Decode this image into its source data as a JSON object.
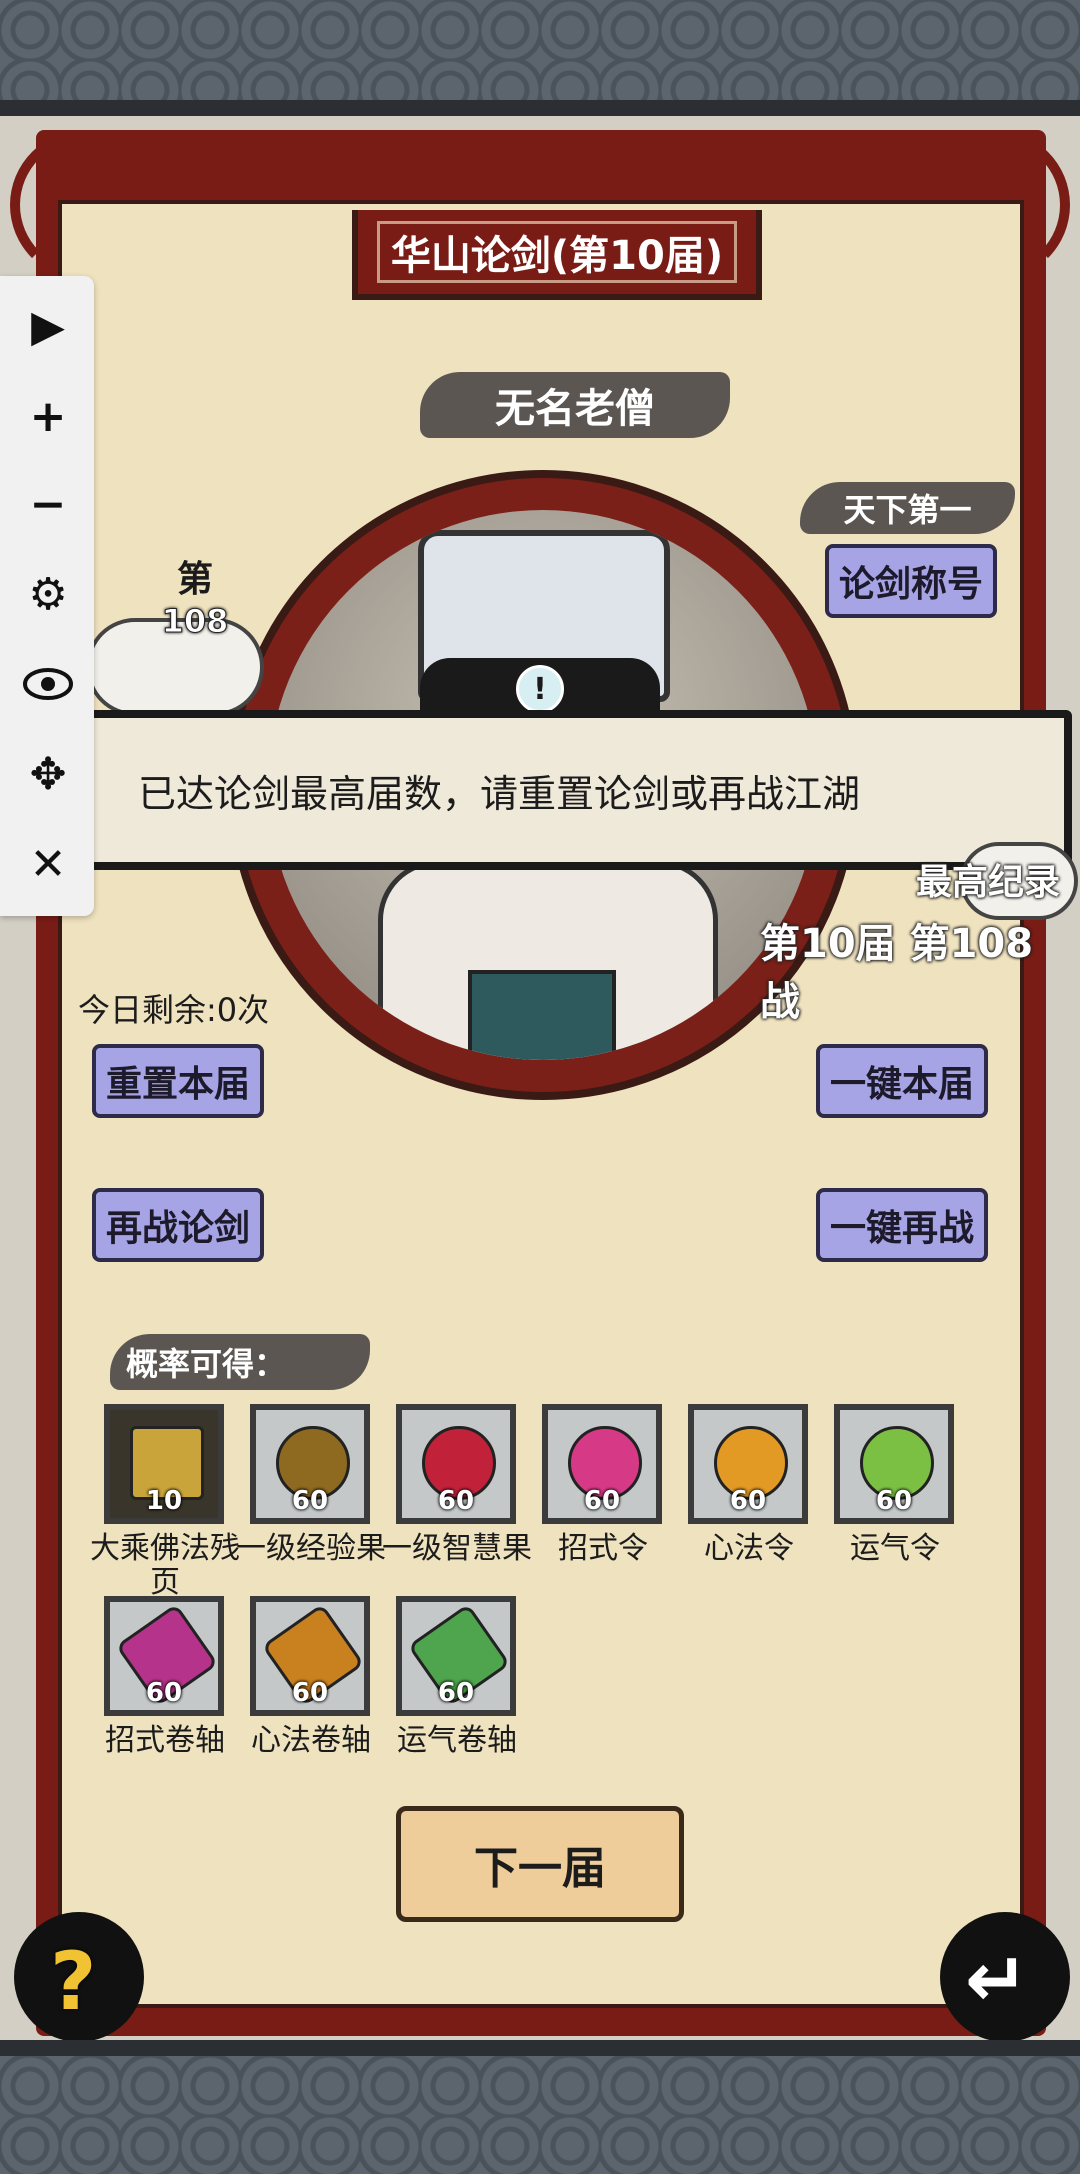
{
  "header": {
    "title": "华山论剑(第10届)"
  },
  "opponent": {
    "name": "无名老僧"
  },
  "title_badge": {
    "rank_text": "天下第一",
    "button_label": "论剑称号"
  },
  "rank": {
    "di": "第",
    "number": "108"
  },
  "notice": {
    "message": "已达论剑最高届数，请重置论剑或再战江湖"
  },
  "record": {
    "title": "最高纪录",
    "value": "第10届 第108战"
  },
  "remaining": "今日剩余:0次",
  "buttons": {
    "reset": "重置本届",
    "one_key_this": "一键本届",
    "rechallenge": "再战论剑",
    "one_key_again": "一键再战",
    "next": "下一届"
  },
  "rewards": {
    "heading": "概率可得：",
    "items": [
      {
        "name": "大乘佛法残页",
        "count": "10"
      },
      {
        "name": "一级经验果",
        "count": "60"
      },
      {
        "name": "一级智慧果",
        "count": "60"
      },
      {
        "name": "招式令",
        "count": "60"
      },
      {
        "name": "心法令",
        "count": "60"
      },
      {
        "name": "运气令",
        "count": "60"
      },
      {
        "name": "招式卷轴",
        "count": "60"
      },
      {
        "name": "心法卷轴",
        "count": "60"
      },
      {
        "name": "运气卷轴",
        "count": "60"
      }
    ]
  },
  "toolbar": {
    "icons": [
      "play-icon",
      "plus-icon",
      "minus-icon",
      "gear-icon",
      "eye-icon",
      "move-icon",
      "close-icon"
    ]
  },
  "colors": {
    "frame_red": "#7a1c16",
    "paper": "#efe2bf",
    "button_purple": "#a7a4e6",
    "next_button": "#efcd9a"
  }
}
